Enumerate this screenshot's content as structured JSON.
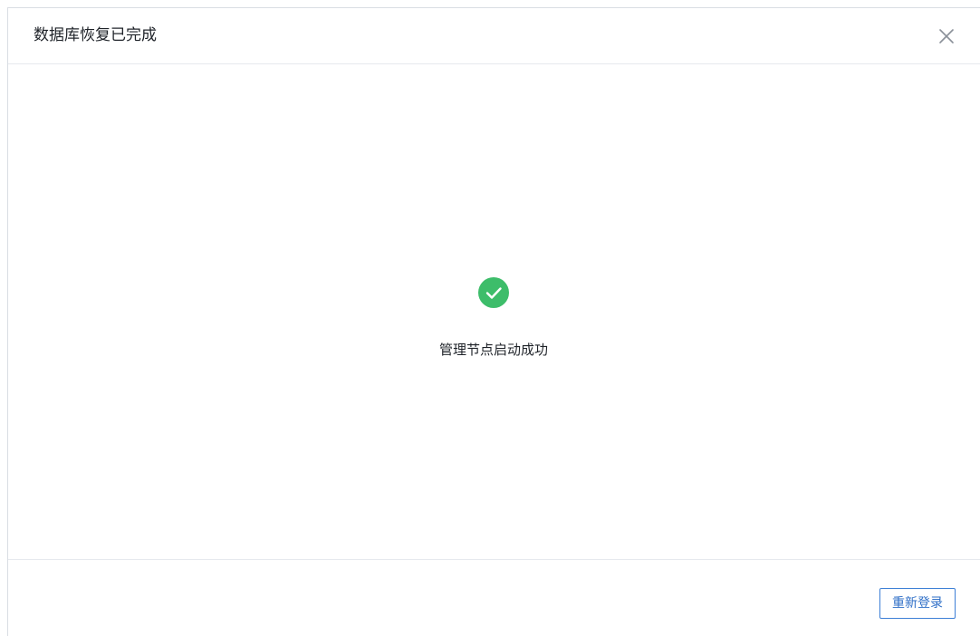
{
  "dialog": {
    "title": "数据库恢复已完成",
    "close_icon": "close-icon"
  },
  "result": {
    "status_icon": "check-circle-icon",
    "status_color": "#3dbd6a",
    "message": "管理节点启动成功"
  },
  "footer": {
    "relogin_label": "重新登录"
  },
  "colors": {
    "accent": "#3d7fd6",
    "success": "#3dbd6a",
    "divider": "#e6e9ee"
  }
}
